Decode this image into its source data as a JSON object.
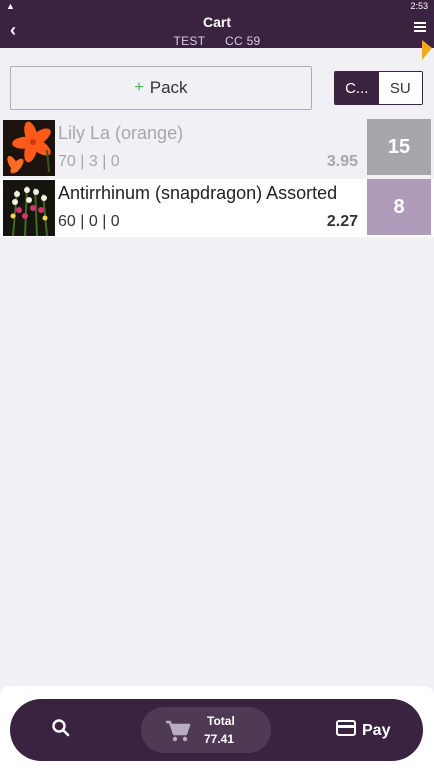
{
  "status_bar": {
    "warn_icon": "warning-triangle-icon",
    "time": "2:53"
  },
  "header": {
    "title": "Cart",
    "subtitle_left": "TEST",
    "subtitle_right": "CC 59"
  },
  "pack": {
    "plus": "+",
    "label": "Pack"
  },
  "segment": {
    "option_active": "C...",
    "option_inactive": "SU"
  },
  "items": [
    {
      "name": "Lily La (orange)",
      "stock": "70 | 3 | 0",
      "price": "3.95",
      "qty": "15"
    },
    {
      "name": "Antirrhinum (snapdragon) Assorted",
      "stock": "60 | 0 | 0",
      "price": "2.27",
      "qty": "8"
    }
  ],
  "bottom": {
    "total_label": "Total",
    "total_value": "77.41",
    "pay_label": "Pay"
  },
  "colors": {
    "primary": "#3a2340",
    "qty_muted": "#a8a6ad",
    "qty_active": "#ae9cba",
    "plus_green": "#4caf50"
  }
}
